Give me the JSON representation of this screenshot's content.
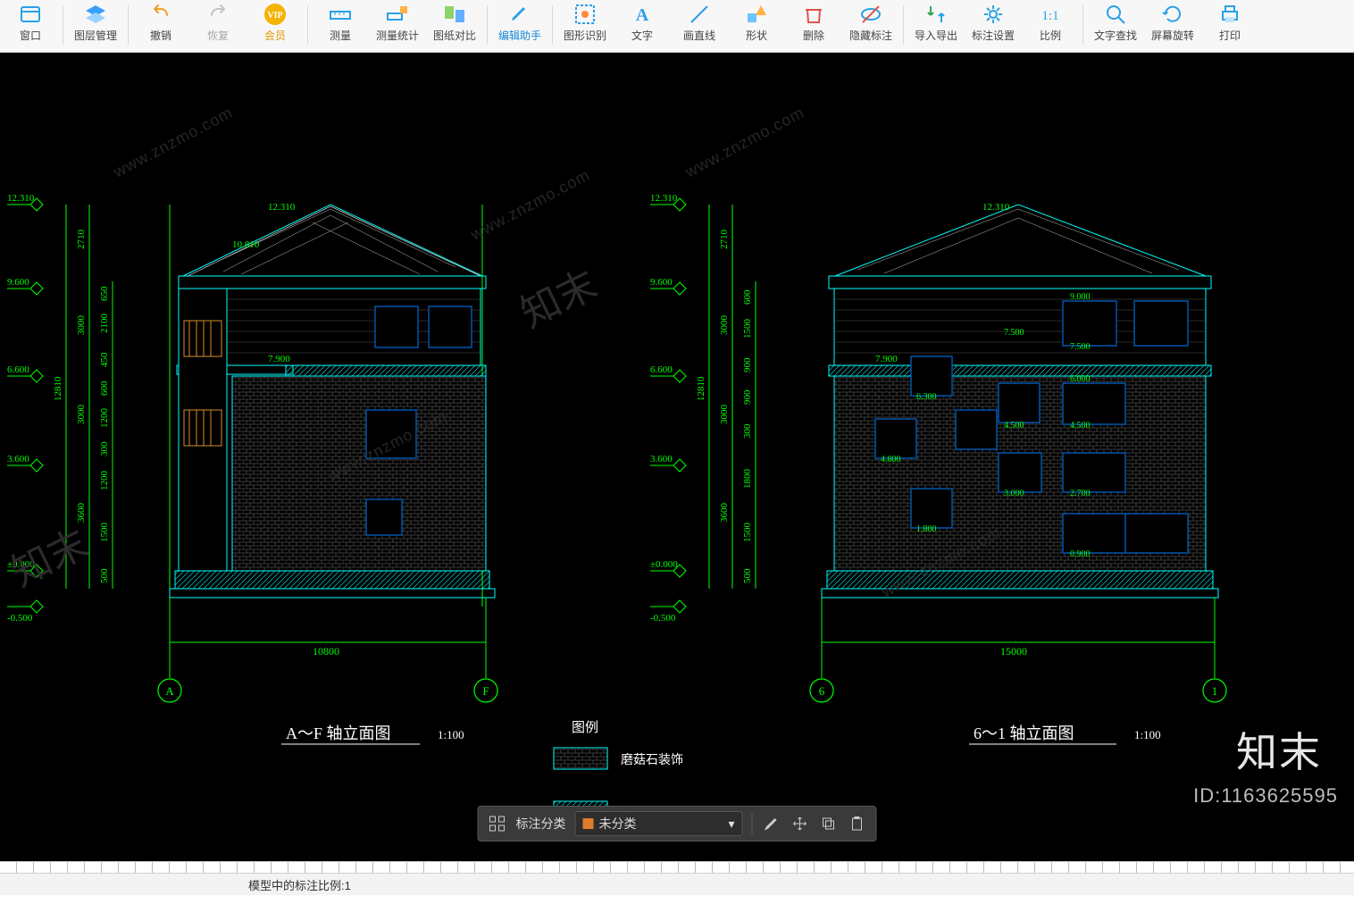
{
  "toolbar": {
    "items": [
      {
        "id": "window",
        "label": "窗口"
      },
      {
        "id": "layer",
        "label": "图层管理"
      },
      {
        "id": "undo",
        "label": "撤销"
      },
      {
        "id": "redo",
        "label": "恢复"
      },
      {
        "id": "vip",
        "label": "会员"
      },
      {
        "id": "measure",
        "label": "测量"
      },
      {
        "id": "measure-stat",
        "label": "测量统计"
      },
      {
        "id": "paper-compare",
        "label": "图纸对比"
      },
      {
        "id": "edit-helper",
        "label": "编辑助手"
      },
      {
        "id": "shape-recog",
        "label": "图形识别"
      },
      {
        "id": "text",
        "label": "文字"
      },
      {
        "id": "line",
        "label": "画直线"
      },
      {
        "id": "shape",
        "label": "形状"
      },
      {
        "id": "delete",
        "label": "删除"
      },
      {
        "id": "hide-annot",
        "label": "隐藏标注"
      },
      {
        "id": "import-export",
        "label": "导入导出"
      },
      {
        "id": "annot-settings",
        "label": "标注设置"
      },
      {
        "id": "scale",
        "label": "比例"
      },
      {
        "id": "text-find",
        "label": "文字查找"
      },
      {
        "id": "rotate",
        "label": "屏幕旋转"
      },
      {
        "id": "print",
        "label": "打印"
      }
    ]
  },
  "floatbar": {
    "category_label": "标注分类",
    "selected": "未分类"
  },
  "status": {
    "scale_text": "模型中的标注比例:1"
  },
  "watermarks": {
    "url": "www.znzmo.com",
    "cn": "知末"
  },
  "brand": "知末",
  "id_tag": "ID:1163625595",
  "left_view": {
    "title": "A～F 轴立面图",
    "scale": "1:100",
    "axis_left": "A",
    "axis_right": "F",
    "width_dim": "10800",
    "overall_dim": "12810",
    "roof_top": "12.310",
    "ridge": "10.810",
    "lv7900": "7.900",
    "levels": [
      "12.310",
      "9.600",
      "6.600",
      "3.600",
      "±0.000",
      "-0.500"
    ],
    "seg_large": [
      "2710",
      "3000",
      "3000",
      "3600"
    ],
    "seg_small": [
      "650",
      "2100",
      "450",
      "600",
      "1200",
      "300",
      "1200",
      "1500",
      "500"
    ]
  },
  "right_view": {
    "title": "6～1 轴立面图",
    "scale": "1:100",
    "axis_left": "6",
    "axis_right": "1",
    "width_dim": "15000",
    "overall_dim": "12810",
    "roof_top": "12.310",
    "lv7900": "7.900",
    "levels": [
      "12.310",
      "9.600",
      "6.600",
      "3.600",
      "±0.000",
      "-0.500"
    ],
    "seg_large": [
      "2710",
      "3000",
      "3000",
      "3600"
    ],
    "seg_small": [
      "600",
      "1500",
      "900",
      "900",
      "300",
      "1800",
      "1500",
      "500"
    ],
    "win_labels": [
      "9.000",
      "7.500",
      "7.500",
      "6.300",
      "6.000",
      "4.800",
      "4.500",
      "4.500",
      "3.000",
      "2.700",
      "1.800",
      "0.900"
    ]
  },
  "legend": {
    "title": "图例",
    "item1": "磨菇石装饰"
  }
}
